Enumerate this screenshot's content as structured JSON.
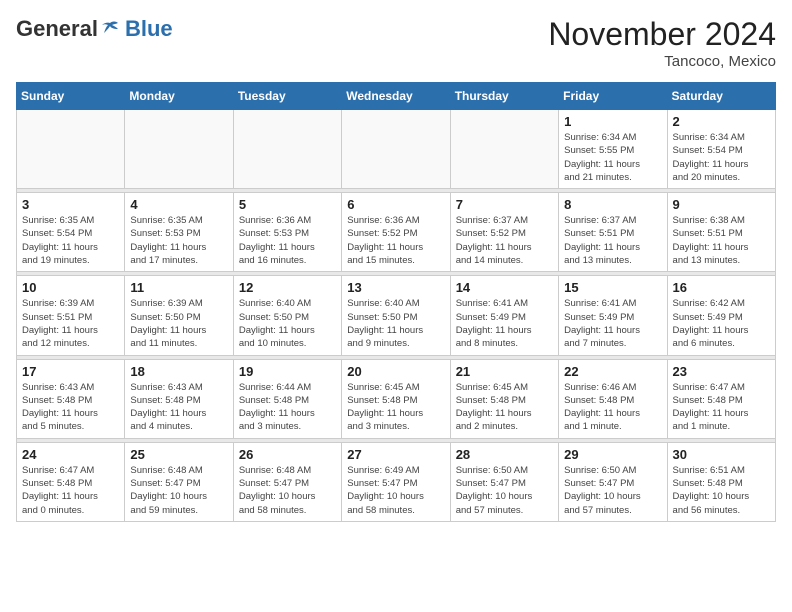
{
  "header": {
    "logo_general": "General",
    "logo_blue": "Blue",
    "month": "November 2024",
    "location": "Tancoco, Mexico"
  },
  "days_of_week": [
    "Sunday",
    "Monday",
    "Tuesday",
    "Wednesday",
    "Thursday",
    "Friday",
    "Saturday"
  ],
  "weeks": [
    [
      {
        "day": "",
        "detail": ""
      },
      {
        "day": "",
        "detail": ""
      },
      {
        "day": "",
        "detail": ""
      },
      {
        "day": "",
        "detail": ""
      },
      {
        "day": "",
        "detail": ""
      },
      {
        "day": "1",
        "detail": "Sunrise: 6:34 AM\nSunset: 5:55 PM\nDaylight: 11 hours\nand 21 minutes."
      },
      {
        "day": "2",
        "detail": "Sunrise: 6:34 AM\nSunset: 5:54 PM\nDaylight: 11 hours\nand 20 minutes."
      }
    ],
    [
      {
        "day": "3",
        "detail": "Sunrise: 6:35 AM\nSunset: 5:54 PM\nDaylight: 11 hours\nand 19 minutes."
      },
      {
        "day": "4",
        "detail": "Sunrise: 6:35 AM\nSunset: 5:53 PM\nDaylight: 11 hours\nand 17 minutes."
      },
      {
        "day": "5",
        "detail": "Sunrise: 6:36 AM\nSunset: 5:53 PM\nDaylight: 11 hours\nand 16 minutes."
      },
      {
        "day": "6",
        "detail": "Sunrise: 6:36 AM\nSunset: 5:52 PM\nDaylight: 11 hours\nand 15 minutes."
      },
      {
        "day": "7",
        "detail": "Sunrise: 6:37 AM\nSunset: 5:52 PM\nDaylight: 11 hours\nand 14 minutes."
      },
      {
        "day": "8",
        "detail": "Sunrise: 6:37 AM\nSunset: 5:51 PM\nDaylight: 11 hours\nand 13 minutes."
      },
      {
        "day": "9",
        "detail": "Sunrise: 6:38 AM\nSunset: 5:51 PM\nDaylight: 11 hours\nand 13 minutes."
      }
    ],
    [
      {
        "day": "10",
        "detail": "Sunrise: 6:39 AM\nSunset: 5:51 PM\nDaylight: 11 hours\nand 12 minutes."
      },
      {
        "day": "11",
        "detail": "Sunrise: 6:39 AM\nSunset: 5:50 PM\nDaylight: 11 hours\nand 11 minutes."
      },
      {
        "day": "12",
        "detail": "Sunrise: 6:40 AM\nSunset: 5:50 PM\nDaylight: 11 hours\nand 10 minutes."
      },
      {
        "day": "13",
        "detail": "Sunrise: 6:40 AM\nSunset: 5:50 PM\nDaylight: 11 hours\nand 9 minutes."
      },
      {
        "day": "14",
        "detail": "Sunrise: 6:41 AM\nSunset: 5:49 PM\nDaylight: 11 hours\nand 8 minutes."
      },
      {
        "day": "15",
        "detail": "Sunrise: 6:41 AM\nSunset: 5:49 PM\nDaylight: 11 hours\nand 7 minutes."
      },
      {
        "day": "16",
        "detail": "Sunrise: 6:42 AM\nSunset: 5:49 PM\nDaylight: 11 hours\nand 6 minutes."
      }
    ],
    [
      {
        "day": "17",
        "detail": "Sunrise: 6:43 AM\nSunset: 5:48 PM\nDaylight: 11 hours\nand 5 minutes."
      },
      {
        "day": "18",
        "detail": "Sunrise: 6:43 AM\nSunset: 5:48 PM\nDaylight: 11 hours\nand 4 minutes."
      },
      {
        "day": "19",
        "detail": "Sunrise: 6:44 AM\nSunset: 5:48 PM\nDaylight: 11 hours\nand 3 minutes."
      },
      {
        "day": "20",
        "detail": "Sunrise: 6:45 AM\nSunset: 5:48 PM\nDaylight: 11 hours\nand 3 minutes."
      },
      {
        "day": "21",
        "detail": "Sunrise: 6:45 AM\nSunset: 5:48 PM\nDaylight: 11 hours\nand 2 minutes."
      },
      {
        "day": "22",
        "detail": "Sunrise: 6:46 AM\nSunset: 5:48 PM\nDaylight: 11 hours\nand 1 minute."
      },
      {
        "day": "23",
        "detail": "Sunrise: 6:47 AM\nSunset: 5:48 PM\nDaylight: 11 hours\nand 1 minute."
      }
    ],
    [
      {
        "day": "24",
        "detail": "Sunrise: 6:47 AM\nSunset: 5:48 PM\nDaylight: 11 hours\nand 0 minutes."
      },
      {
        "day": "25",
        "detail": "Sunrise: 6:48 AM\nSunset: 5:47 PM\nDaylight: 10 hours\nand 59 minutes."
      },
      {
        "day": "26",
        "detail": "Sunrise: 6:48 AM\nSunset: 5:47 PM\nDaylight: 10 hours\nand 58 minutes."
      },
      {
        "day": "27",
        "detail": "Sunrise: 6:49 AM\nSunset: 5:47 PM\nDaylight: 10 hours\nand 58 minutes."
      },
      {
        "day": "28",
        "detail": "Sunrise: 6:50 AM\nSunset: 5:47 PM\nDaylight: 10 hours\nand 57 minutes."
      },
      {
        "day": "29",
        "detail": "Sunrise: 6:50 AM\nSunset: 5:47 PM\nDaylight: 10 hours\nand 57 minutes."
      },
      {
        "day": "30",
        "detail": "Sunrise: 6:51 AM\nSunset: 5:48 PM\nDaylight: 10 hours\nand 56 minutes."
      }
    ]
  ]
}
